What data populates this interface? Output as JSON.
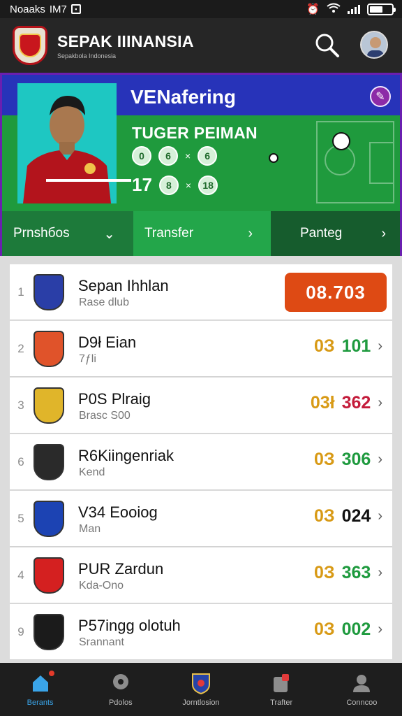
{
  "status_bar": {
    "time": "Noaaks",
    "carrier": "IM7",
    "battery_icon": "battery-icon",
    "wifi_icon": "wifi-icon"
  },
  "header": {
    "title": "SEPAK IIINANSIA",
    "subtitle": "Sepakbola Indonesia",
    "search_icon": "search-icon",
    "profile_icon": "avatar"
  },
  "hero": {
    "title": "VENafering",
    "player_name": "TUGER PEIMAN",
    "stat1_a": "0",
    "stat1_b": "6",
    "stat1_c": "6",
    "stat2_a": "17",
    "stat2_b": "8",
    "stat2_c": "18",
    "separator": "×",
    "edit_icon": "edit-icon"
  },
  "tabs": [
    {
      "label": "Prnshбos",
      "arrow": "⌄"
    },
    {
      "label": "Transfer",
      "arrow": "›"
    },
    {
      "label": "Panteg",
      "arrow": "›"
    }
  ],
  "standings": [
    {
      "rank": "1",
      "name": "Sepan Ihhlan",
      "sub": "Rase dlub",
      "score_a": "08.",
      "score_b": "703",
      "highlight": true,
      "score_color": "#ffffff",
      "logo_color": "#2a3ea7"
    },
    {
      "rank": "2",
      "name": "D9ł Eian",
      "sub": "7ƒli",
      "score_a": "0З",
      "score_b": "101",
      "highlight": false,
      "score_color": "#1e9a3e",
      "logo_color": "#e0532a"
    },
    {
      "rank": "3",
      "name": "P0S Plraig",
      "sub": "Brasc S00",
      "score_a": "03ł",
      "score_b": "362",
      "highlight": false,
      "score_color": "#c41c3b",
      "logo_color": "#e0b52a"
    },
    {
      "rank": "6",
      "name": "R6Kiingenriak",
      "sub": "Kend",
      "score_a": "0З",
      "score_b": "306",
      "highlight": false,
      "score_color": "#1e9a3e",
      "logo_color": "#2a2a2a"
    },
    {
      "rank": "5",
      "name": "V34 Eooiog",
      "sub": "Man",
      "score_a": "0З",
      "score_b": "024",
      "highlight": false,
      "score_color": "#111111",
      "logo_color": "#1c43b3"
    },
    {
      "rank": "4",
      "name": "PUR Zardun",
      "sub": "Kda-Ono",
      "score_a": "0З",
      "score_b": "363",
      "highlight": false,
      "score_color": "#1e9a3e",
      "logo_color": "#d42020"
    },
    {
      "rank": "9",
      "name": "P57ingg olotuh",
      "sub": "Srannant",
      "score_a": "0З",
      "score_b": "002",
      "highlight": false,
      "score_color": "#1e9a3e",
      "logo_color": "#1b1b1b"
    }
  ],
  "bottom_nav": [
    {
      "label": "Berants",
      "icon": "home-icon",
      "active": true
    },
    {
      "label": "Pdolos",
      "icon": "location-icon",
      "active": false
    },
    {
      "label": "Jorntlosion",
      "icon": "club-icon",
      "active": false
    },
    {
      "label": "Trafter",
      "icon": "transfer-icon",
      "active": false
    },
    {
      "label": "Conncoo",
      "icon": "profile-icon",
      "active": false
    }
  ],
  "colors": {
    "accent_green": "#23a64a",
    "hero_blue": "#2733b9",
    "highlight_orange": "#de4a14",
    "nav_active": "#3aa4e8"
  }
}
